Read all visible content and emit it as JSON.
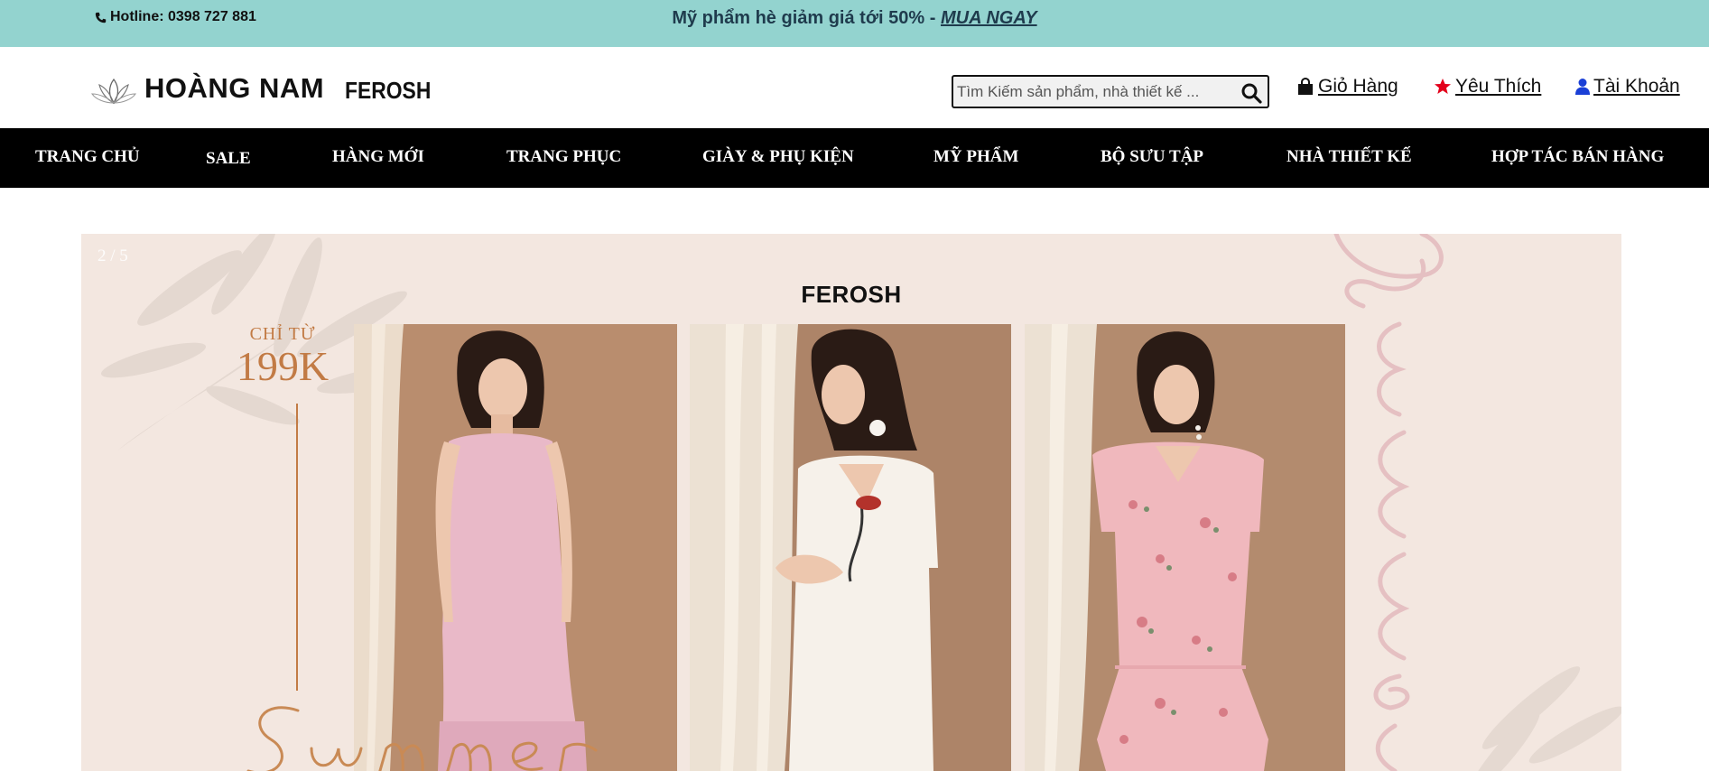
{
  "topbar": {
    "hotline": "Hotline: 0398 727 881",
    "promo_text": "Mỹ phẩm hè giảm giá tới 50% - ",
    "promo_link": "MUA NGAY",
    "bg_color": "#93d3cf"
  },
  "header": {
    "logo_name": "HOÀNG NAM",
    "brand_name": "FEROSH",
    "search_placeholder": "Tìm Kiếm sản phẩm, nhà thiết kế ...",
    "links": {
      "cart": "Giỏ Hàng",
      "wishlist": "Yêu Thích",
      "account": "Tài Khoản"
    },
    "icons": {
      "cart": "shopping-bag-icon",
      "wishlist": "star-icon",
      "account": "user-icon",
      "search": "search-icon"
    }
  },
  "nav": {
    "items": [
      "TRANG CHỦ",
      "SALE",
      "HÀNG MỚI",
      "TRANG PHỤC",
      "GIÀY & PHỤ KIỆN",
      "MỸ PHẨM",
      "BỘ SƯU TẬP",
      "NHÀ THIẾT KẾ",
      "HỢP TÁC BÁN HÀNG"
    ]
  },
  "banner": {
    "slide_counter": "2 / 5",
    "title": "FEROSH",
    "price_from": "CHỈ TỪ",
    "price_value": "199K",
    "accent_color": "#c27b45",
    "bg_color": "#f3e7e0"
  }
}
